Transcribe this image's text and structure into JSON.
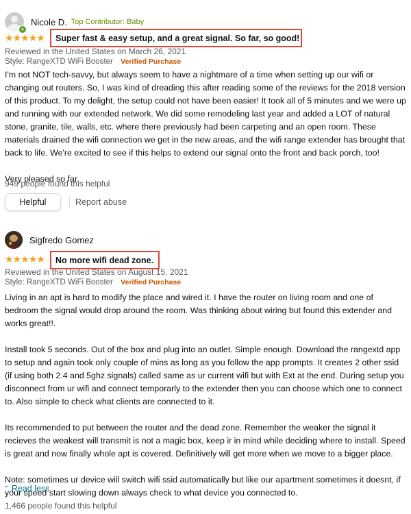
{
  "colors": {
    "star": "#f6a21d",
    "highlight_box": "#e0453a",
    "verified": "#c45500",
    "link": "#007185",
    "contributor": "#6a8a00",
    "muted": "#565959"
  },
  "reviews": [
    {
      "reviewer": "Nicole D.",
      "badge": "Top Contributor: Baby",
      "avatar_icon": "default-profile-icon",
      "rating": 5,
      "rating_max": 5,
      "title": "Super fast & easy setup, and a great signal. So far, so good!",
      "reviewed_line": "Reviewed in the United States on March 26, 2021",
      "style_label": "Style:",
      "style_value": "RangeXTD WiFi Booster",
      "verified": "Verified Purchase",
      "body": [
        "I'm not NOT tech-savvy, but always seem to have a nightmare of a time when setting up our wifi or changing out routers. So, I was kind of dreading this after reading some of the reviews for the 2018 version of this product. To my delight, the setup could not have been easier! It took all of 5 minutes and we were up and running with our extended network. We did some remodeling last year and added a LOT of natural stone, granite, tile, walls, etc. where there previously had been carpeting and an open room. These materials drained the wifi connection we get in the new areas, and the wifi range extender has brought that back to life. We're excited to see if this helps to extend our signal onto the front and back porch, too!",
        "Very pleased so far."
      ],
      "helpful_count": "949 people found this helpful",
      "helpful_button": "Helpful",
      "report": "Report abuse"
    },
    {
      "reviewer": "Sigfredo Gomez",
      "avatar_icon": "user-photo-avatar",
      "rating": 5,
      "rating_max": 5,
      "title": "No more wifi dead zone.",
      "reviewed_line": "Reviewed in the United States on August 15, 2021",
      "style_label": "Style:",
      "style_value": "RangeXTD WiFi Booster",
      "verified": "Verified Purchase",
      "body": [
        "Living in an apt is hard to modify the place and wired it. I have the router on living room and one of bedroom the signal would drop around the room. Was thinking about wiring but found this extender and works great!!.",
        "Install took 5 seconds. Out of the box and plug into an outlet. Simple enough. Download the rangextd app to setup and again took only couple of mins as long as you follow the app prompts. It creates 2 other ssid (if using both 2.4 and 5ghz signals) called same as ur current wifi but with Ext at the end. During setup you disconnect from ur wifi and connect temporarly to the extender then you can choose which one to connect to. Also simple to check what clients are connected to it.",
        "Its recommended to put between the router and the dead zone. Remember the weaker the signal it recieves the weakest will transmit is not a magic box, keep ir in mind while deciding where to install. Speed is great and now finally whole apt is covered. Definitively will get more when we move to a bigger place.",
        "Note: sometimes ur device will switch wifi ssid automatically but like our apartment sometimes it doesnt, if your speed start slowing down always check to what device you connected to."
      ],
      "read_less": "Read less",
      "read_less_icon": "chevron-up-icon",
      "helpful_count": "1,466 people found this helpful"
    }
  ]
}
